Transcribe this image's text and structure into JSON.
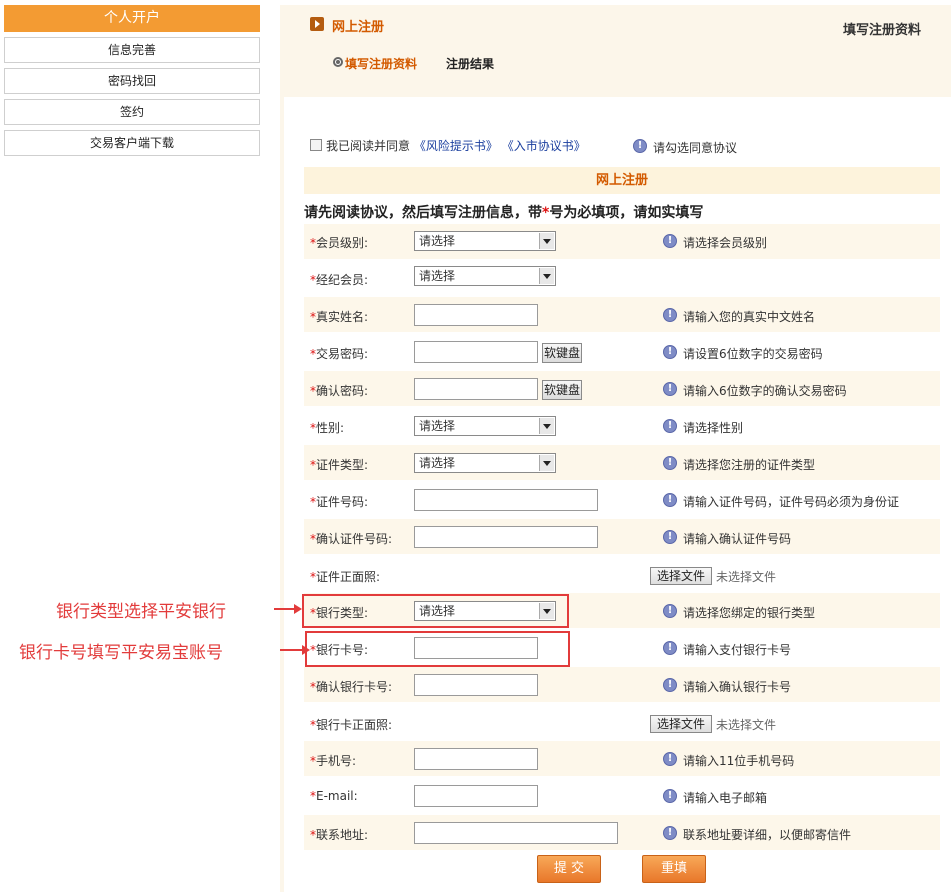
{
  "sidebar": {
    "title": "个人开户",
    "items": [
      "信息完善",
      "密码找回",
      "签约",
      "交易客户端下载"
    ]
  },
  "header": {
    "crumb": "网上注册",
    "right_title": "填写注册资料",
    "steps": [
      "填写注册资料",
      "注册结果"
    ]
  },
  "agree": {
    "prefix": "我已阅读并同意",
    "link1": "《风险提示书》",
    "link2": "《入市协议书》",
    "hint": "请勾选同意协议"
  },
  "section_title": "网上注册",
  "instruction": {
    "part1": "请先阅读协议，然后填写注册信息，带",
    "star": "*",
    "part2": "号为必填项，请如实填写"
  },
  "select_placeholder": "请选择",
  "soft_keyboard": "软键盘",
  "file_button": "选择文件",
  "file_none": "未选择文件",
  "fields": [
    {
      "label": "会员级别:",
      "hint": "请选择会员级别"
    },
    {
      "label": "经纪会员:",
      "hint": ""
    },
    {
      "label": "真实姓名:",
      "hint": "请输入您的真实中文姓名"
    },
    {
      "label": "交易密码:",
      "hint": "请设置6位数字的交易密码"
    },
    {
      "label": "确认密码:",
      "hint": "请输入6位数字的确认交易密码"
    },
    {
      "label": "性别:",
      "hint": "请选择性别"
    },
    {
      "label": "证件类型:",
      "hint": "请选择您注册的证件类型"
    },
    {
      "label": "证件号码:",
      "hint": "请输入证件号码，证件号码必须为身份证"
    },
    {
      "label": "确认证件号码:",
      "hint": "请输入确认证件号码"
    },
    {
      "label": "证件正面照:",
      "hint": ""
    },
    {
      "label": "银行类型:",
      "hint": "请选择您绑定的银行类型"
    },
    {
      "label": "银行卡号:",
      "hint": "请输入支付银行卡号"
    },
    {
      "label": "确认银行卡号:",
      "hint": "请输入确认银行卡号"
    },
    {
      "label": "银行卡正面照:",
      "hint": ""
    },
    {
      "label": "手机号:",
      "hint": "请输入11位手机号码"
    },
    {
      "label": "E-mail:",
      "hint": "请输入电子邮箱"
    },
    {
      "label": "联系地址:",
      "hint": "联系地址要详细，以便邮寄信件"
    }
  ],
  "annotations": {
    "bank_type": "银行类型选择平安银行",
    "bank_card": "银行卡号填写平安易宝账号"
  },
  "buttons": {
    "submit": "提 交",
    "reset": "重填"
  },
  "colors": {
    "accent": "#f39b33",
    "annotation": "#e23b3b",
    "title": "#d35a00"
  }
}
